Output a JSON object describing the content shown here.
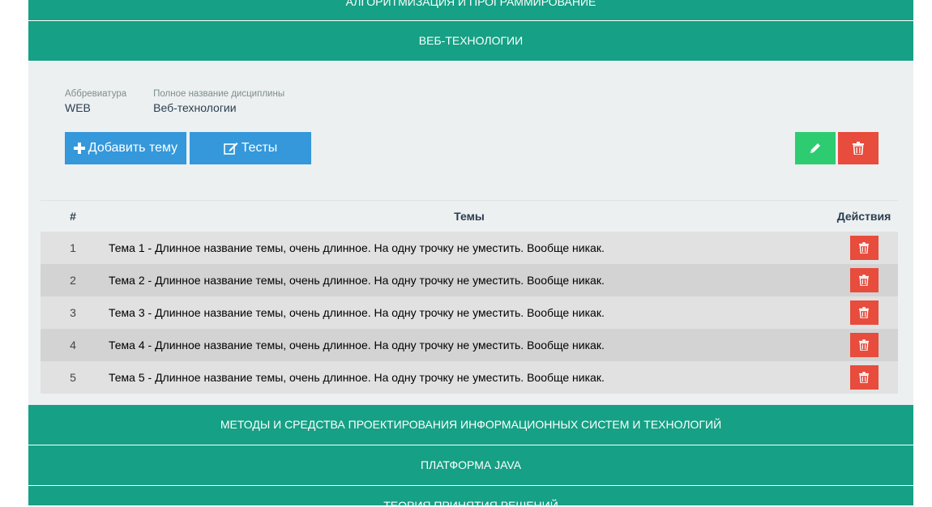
{
  "sections": {
    "top": "АЛГОРИТМИЗАЦИЯ И ПРОГРАММИРОВАНИЕ",
    "active": "ВЕБ-ТЕХНОЛОГИИ",
    "after1": "МЕТОДЫ И СРЕДСТВА ПРОЕКТИРОВАНИЯ ИНФОРМАЦИОННЫХ СИСТЕМ И ТЕХНОЛОГИЙ",
    "after2": "ПЛАТФОРМА JAVA",
    "after3": "ТЕОРИЯ ПРИНЯТИЯ РЕШЕНИЙ"
  },
  "discipline": {
    "abbr_label": "Аббревиатура",
    "abbr_value": "WEB",
    "name_label": "Полное название дисциплины",
    "name_value": "Веб-технологии"
  },
  "buttons": {
    "add_topic": "Добавить тему",
    "tests": "Тесты"
  },
  "table": {
    "headers": {
      "num": "#",
      "topics": "Темы",
      "actions": "Действия"
    },
    "rows": [
      {
        "num": "1",
        "topic": "Тема 1 - Длинное название темы, очень длинное. На одну трочку не уместить. Вообще никак."
      },
      {
        "num": "2",
        "topic": "Тема 2 - Длинное название темы, очень длинное. На одну трочку не уместить. Вообще никак."
      },
      {
        "num": "3",
        "topic": "Тема 3 - Длинное название темы, очень длинное. На одну трочку не уместить. Вообще никак."
      },
      {
        "num": "4",
        "topic": "Тема 4 - Длинное название темы, очень длинное. На одну трочку не уместить. Вообще никак."
      },
      {
        "num": "5",
        "topic": "Тема 5 - Длинное название темы, очень длинное. На одну трочку не уместить. Вообще никак."
      }
    ]
  },
  "icons": {
    "add": "plus-icon",
    "tests": "edit-square-icon",
    "edit": "pencil-icon",
    "delete": "trash-icon"
  },
  "colors": {
    "section_header": "#16a085",
    "primary_button": "#3498db",
    "edit_button": "#2ecc71",
    "delete_button": "#e74c3c",
    "panel_background": "#ecf0f1"
  }
}
